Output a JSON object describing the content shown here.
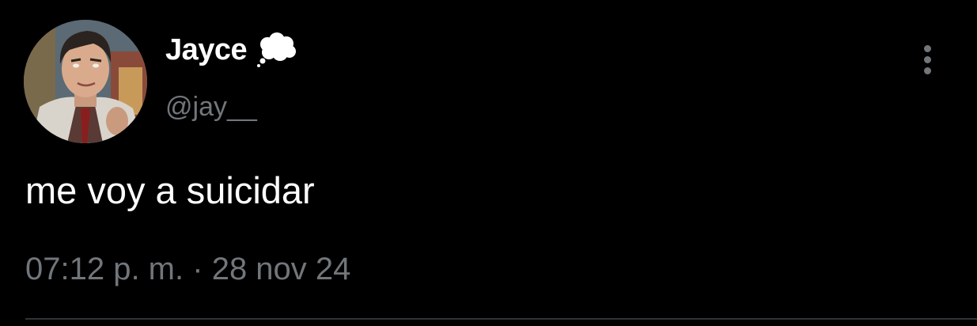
{
  "tweet": {
    "author": {
      "display_name": "Jayce",
      "handle": "@jay__",
      "status_icon": "thought-bubble-icon",
      "avatar": "avatar-icon"
    },
    "text": "me voy a suicidar",
    "time": "07:12 p. m.",
    "separator": "·",
    "date": "28 nov 24",
    "more_icon": "more-vertical-icon"
  },
  "colors": {
    "background": "#000000",
    "primary_text": "#ffffff",
    "secondary_text": "#71767b",
    "divider": "#2f3336"
  }
}
